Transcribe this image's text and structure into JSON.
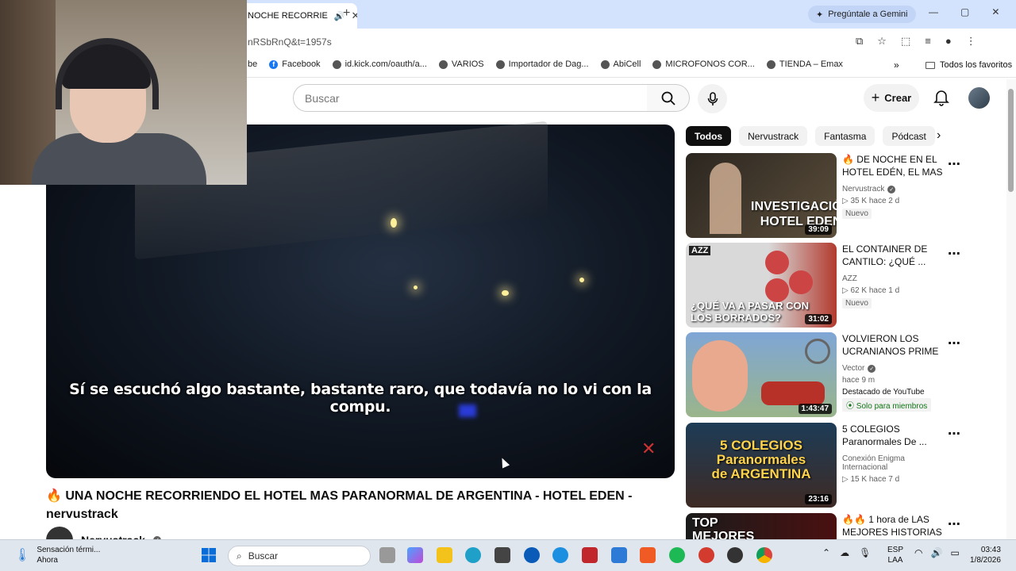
{
  "browser": {
    "tab_title": "NOCHE RECORRIE",
    "gemini_label": "Pregúntale a Gemini",
    "url_fragment": "nRSbRnQ&t=1957s",
    "bookmarks": [
      "be",
      "Facebook",
      "id.kick.com/oauth/a...",
      "VARIOS",
      "Importador de Dag...",
      "AbiCell",
      "MICROFONOS COR...",
      "TIENDA – Emax"
    ],
    "bookmarks_more": "»",
    "all_favorites": "Todos los favoritos"
  },
  "youtube": {
    "search_placeholder": "Buscar",
    "create_label": "Crear"
  },
  "video": {
    "subtitle": "Sí se escuchó algo bastante, bastante raro, que todavía no lo vi con la compu.",
    "title": "🔥 UNA NOCHE RECORRIENDO EL HOTEL MAS PARANORMAL DE ARGENTINA - HOTEL EDEN - nervustrack",
    "channel": "Nervustrack",
    "watermark": "✕"
  },
  "chips": [
    "Todos",
    "Nervustrack",
    "Fantasma",
    "Pódcast"
  ],
  "recommendations": [
    {
      "title": "🔥 DE NOCHE EN EL HOTEL EDÉN, EL MAS ...",
      "channel": "Nervustrack",
      "verified": true,
      "stats": "▷ 35 K  hace 2 d",
      "badge": "Nuevo",
      "duration": "39:09",
      "thumb_text": "INVESTIGACIÓN\nHOTEL EDEN",
      "colors": [
        "#2b2620",
        "#5c4e3b"
      ]
    },
    {
      "title": "EL CONTAINER DE CANTILO: ¿QUÉ ...",
      "channel": "AZZ",
      "verified": false,
      "stats": "▷ 62 K  hace 1 d",
      "badge": "Nuevo",
      "duration": "31:02",
      "thumb_text": "¿QUÉ VA A PASAR CON\nLOS BORRADOS?",
      "colors": [
        "#d9d9d9",
        "#b23a2e"
      ]
    },
    {
      "title": "VOLVIERON LOS UCRANIANOS PRIME",
      "channel": "Vector",
      "verified": true,
      "stats": "hace 9 m",
      "featured": "Destacado de YouTube",
      "members": "Solo para miembros",
      "duration": "1:43:47",
      "thumb_text": "",
      "colors": [
        "#7fa6d6",
        "#b83128"
      ]
    },
    {
      "title": "5 COLEGIOS Paranormales De ...",
      "channel": "Conexión Enigma Internacional",
      "verified": false,
      "stats": "▷ 15 K  hace 7 d",
      "duration": "23:16",
      "thumb_text": "5 COLEGIOS\nParanormales\nde ARGENTINA",
      "colors": [
        "#1d3c57",
        "#5a2a1e"
      ]
    },
    {
      "title": "🔥🔥 1 hora de LAS MEJORES HISTORIAS ...",
      "thumb_text": "TOP\nMEJORES",
      "colors": [
        "#1b1b1b",
        "#4a1010"
      ]
    }
  ],
  "taskbar": {
    "weather_title": "Sensación térmi...",
    "weather_sub": "Ahora",
    "search_label": "Buscar",
    "lang_1": "ESP",
    "lang_2": "LAA",
    "time": "03:43",
    "date": "1/8/2026"
  }
}
